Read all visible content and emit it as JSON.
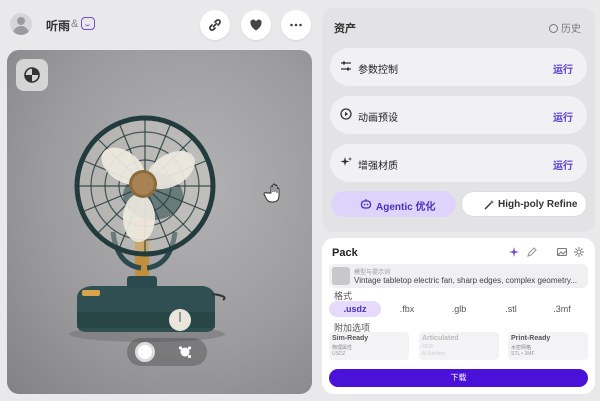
{
  "header": {
    "username": "听雨",
    "separator": "&",
    "buttons": [
      {
        "name": "link-button",
        "icon": "link-icon"
      },
      {
        "name": "favorite-button",
        "icon": "heart-icon"
      },
      {
        "name": "more-button",
        "icon": "more-icon"
      }
    ]
  },
  "viewport": {
    "corner_icon": "display-mode-icon",
    "toggle_alt_icon": "texture-icon"
  },
  "assets": {
    "title": "资产",
    "history_label": "历史",
    "rows": [
      {
        "label": "参数控制",
        "action": "运行",
        "icon": "sliders-icon"
      },
      {
        "label": "动画预设",
        "action": "运行",
        "icon": "play-icon"
      },
      {
        "label": "增强材质",
        "action": "运行",
        "icon": "sparkle-icon"
      }
    ],
    "agentic_label": "Agentic 优化",
    "highpoly_label": "High-poly Refine"
  },
  "pack": {
    "title": "Pack",
    "prompt_tag": "模型与提示词",
    "prompt_text": "Vintage tabletop electric fan, sharp edges, complex geometry...",
    "format_label": "格式",
    "formats": [
      ".usdz",
      ".fbx",
      ".glb",
      ".stl",
      ".3mf"
    ],
    "selected_format": ".usdz",
    "options_label": "附加选项",
    "options": [
      {
        "title": "Sim-Ready",
        "sub1": "物理属性",
        "sub2": "USDZ",
        "enabled": true
      },
      {
        "title": "Articulated",
        "sub1": "OCR",
        "sub2": "AI Kitchen",
        "enabled": false
      },
      {
        "title": "Print-Ready",
        "sub1": "水密网格",
        "sub2": "STL • 3MF",
        "enabled": true
      }
    ],
    "download_label": "下载"
  },
  "colors": {
    "accent": "#5b3fd0",
    "download": "#4a12d8",
    "agentic_bg": "#ded4fb"
  }
}
